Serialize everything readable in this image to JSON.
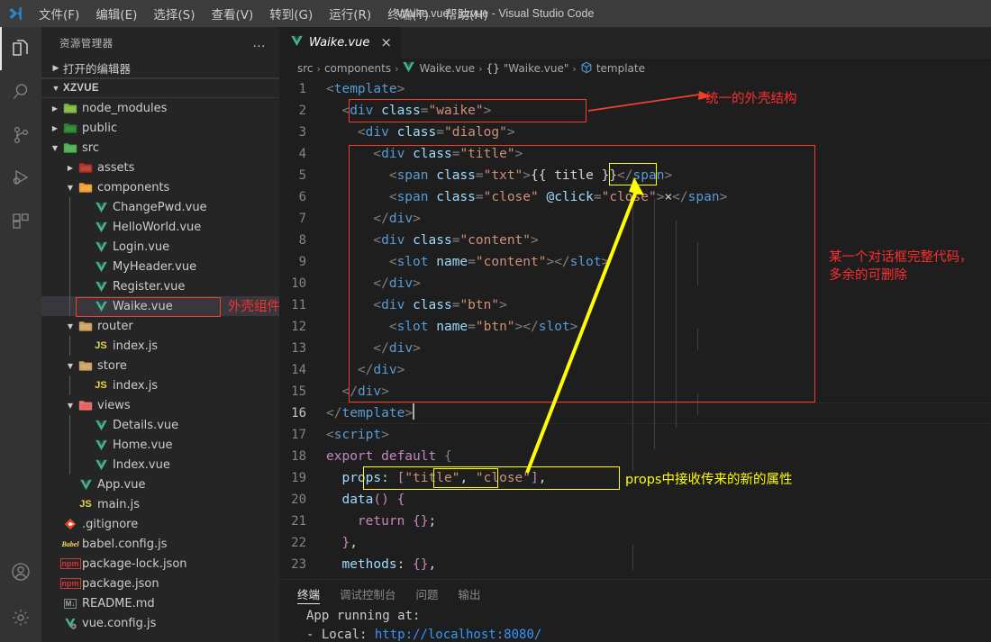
{
  "window": {
    "title": "Waike.vue - xzvue - Visual Studio Code"
  },
  "menu": {
    "items": [
      {
        "label": "文件(F)"
      },
      {
        "label": "编辑(E)"
      },
      {
        "label": "选择(S)"
      },
      {
        "label": "查看(V)"
      },
      {
        "label": "转到(G)"
      },
      {
        "label": "运行(R)"
      },
      {
        "label": "终端(T)"
      },
      {
        "label": "帮助(H)"
      }
    ]
  },
  "activitybar": {
    "items": [
      {
        "name": "explorer-icon",
        "active": true
      },
      {
        "name": "search-icon",
        "active": false
      },
      {
        "name": "source-control-icon",
        "active": false
      },
      {
        "name": "run-debug-icon",
        "active": false
      },
      {
        "name": "extensions-icon",
        "active": false
      }
    ],
    "bottom": [
      {
        "name": "account-icon"
      },
      {
        "name": "settings-gear-icon"
      }
    ]
  },
  "sidebar": {
    "header_title": "资源管理器",
    "more_actions": "…",
    "open_editors_label": "打开的编辑器",
    "project_label": "XZVUE",
    "tree": [
      {
        "label": "node_modules",
        "type": "folder",
        "depth": 1,
        "twisty": "collapsed",
        "icon": "folder-node-modules-icon"
      },
      {
        "label": "public",
        "type": "folder",
        "depth": 1,
        "twisty": "collapsed",
        "icon": "folder-public-icon"
      },
      {
        "label": "src",
        "type": "folder",
        "depth": 1,
        "twisty": "expanded",
        "icon": "folder-src-icon"
      },
      {
        "label": "assets",
        "type": "folder",
        "depth": 2,
        "twisty": "collapsed",
        "icon": "folder-assets-icon"
      },
      {
        "label": "components",
        "type": "folder",
        "depth": 2,
        "twisty": "expanded",
        "icon": "folder-components-icon"
      },
      {
        "label": "ChangePwd.vue",
        "type": "vue",
        "depth": 3,
        "twisty": "none",
        "icon": "vue-file-icon"
      },
      {
        "label": "HelloWorld.vue",
        "type": "vue",
        "depth": 3,
        "twisty": "none",
        "icon": "vue-file-icon"
      },
      {
        "label": "Login.vue",
        "type": "vue",
        "depth": 3,
        "twisty": "none",
        "icon": "vue-file-icon"
      },
      {
        "label": "MyHeader.vue",
        "type": "vue",
        "depth": 3,
        "twisty": "none",
        "icon": "vue-file-icon"
      },
      {
        "label": "Register.vue",
        "type": "vue",
        "depth": 3,
        "twisty": "none",
        "icon": "vue-file-icon"
      },
      {
        "label": "Waike.vue",
        "type": "vue",
        "depth": 3,
        "twisty": "none",
        "icon": "vue-file-icon",
        "selected": true
      },
      {
        "label": "router",
        "type": "folder",
        "depth": 2,
        "twisty": "expanded",
        "icon": "folder-icon"
      },
      {
        "label": "index.js",
        "type": "js",
        "depth": 3,
        "twisty": "none",
        "icon": "js-file-icon"
      },
      {
        "label": "store",
        "type": "folder",
        "depth": 2,
        "twisty": "expanded",
        "icon": "folder-icon"
      },
      {
        "label": "index.js",
        "type": "js",
        "depth": 3,
        "twisty": "none",
        "icon": "js-file-icon"
      },
      {
        "label": "views",
        "type": "folder",
        "depth": 2,
        "twisty": "expanded",
        "icon": "folder-views-icon"
      },
      {
        "label": "Details.vue",
        "type": "vue",
        "depth": 3,
        "twisty": "none",
        "icon": "vue-file-icon"
      },
      {
        "label": "Home.vue",
        "type": "vue",
        "depth": 3,
        "twisty": "none",
        "icon": "vue-file-icon"
      },
      {
        "label": "Index.vue",
        "type": "vue",
        "depth": 3,
        "twisty": "none",
        "icon": "vue-file-icon"
      },
      {
        "label": "App.vue",
        "type": "vue",
        "depth": 2,
        "twisty": "none",
        "icon": "vue-file-icon"
      },
      {
        "label": "main.js",
        "type": "js",
        "depth": 2,
        "twisty": "none",
        "icon": "js-file-icon"
      },
      {
        "label": ".gitignore",
        "type": "git",
        "depth": 1,
        "twisty": "none",
        "icon": "git-file-icon"
      },
      {
        "label": "babel.config.js",
        "type": "babel",
        "depth": 1,
        "twisty": "none",
        "icon": "babel-file-icon"
      },
      {
        "label": "package-lock.json",
        "type": "npm",
        "depth": 1,
        "twisty": "none",
        "icon": "npm-file-icon"
      },
      {
        "label": "package.json",
        "type": "npm",
        "depth": 1,
        "twisty": "none",
        "icon": "npm-file-icon"
      },
      {
        "label": "README.md",
        "type": "md",
        "depth": 1,
        "twisty": "none",
        "icon": "markdown-file-icon"
      },
      {
        "label": "vue.config.js",
        "type": "vueconfig",
        "depth": 1,
        "twisty": "none",
        "icon": "vue-config-file-icon"
      }
    ]
  },
  "editor": {
    "tab_label": "Waike.vue",
    "tab_close": "×",
    "breadcrumb": [
      {
        "label": "src",
        "icon": ""
      },
      {
        "label": "components",
        "icon": ""
      },
      {
        "label": "Waike.vue",
        "icon": "vue-file-icon"
      },
      {
        "label": "\"Waike.vue\"",
        "icon": "braces-icon"
      },
      {
        "label": "template",
        "icon": "symbol-module-icon"
      }
    ],
    "lines": [
      {
        "n": "1",
        "html": "<span class='brk'>&lt;</span><span class='tag'>template</span><span class='brk'>&gt;</span>"
      },
      {
        "n": "2",
        "html": "  <span class='brk'>&lt;</span><span class='tag'>div</span> <span class='attr'>class</span><span class='brk'>=</span><span class='str'>\"waike\"</span><span class='brk'>&gt;</span>"
      },
      {
        "n": "3",
        "html": "    <span class='brk'>&lt;</span><span class='tag'>div</span> <span class='attr'>class</span><span class='brk'>=</span><span class='str'>\"dialog\"</span><span class='brk'>&gt;</span>"
      },
      {
        "n": "4",
        "html": "      <span class='brk'>&lt;</span><span class='tag'>div</span> <span class='attr'>class</span><span class='brk'>=</span><span class='str'>\"title\"</span><span class='brk'>&gt;</span>"
      },
      {
        "n": "5",
        "html": "        <span class='brk'>&lt;</span><span class='tag'>span</span> <span class='attr'>class</span><span class='brk'>=</span><span class='str'>\"txt\"</span><span class='brk'>&gt;</span><span class='moust'>{{ title }}</span><span class='brk'>&lt;/</span><span class='tag'>span</span><span class='brk'>&gt;</span>"
      },
      {
        "n": "6",
        "html": "        <span class='brk'>&lt;</span><span class='tag'>span</span> <span class='attr'>class</span><span class='brk'>=</span><span class='str'>\"close\"</span> <span class='attr'>@click</span><span class='brk'>=</span><span class='str'>\"close\"</span><span class='brk'>&gt;</span><span class='txt'>×</span><span class='brk'>&lt;/</span><span class='tag'>span</span><span class='brk'>&gt;</span>"
      },
      {
        "n": "7",
        "html": "      <span class='brk'>&lt;/</span><span class='tag'>div</span><span class='brk'>&gt;</span>"
      },
      {
        "n": "8",
        "html": "      <span class='brk'>&lt;</span><span class='tag'>div</span> <span class='attr'>class</span><span class='brk'>=</span><span class='str'>\"content\"</span><span class='brk'>&gt;</span>"
      },
      {
        "n": "9",
        "html": "        <span class='brk'>&lt;</span><span class='tag'>slot</span> <span class='attr'>name</span><span class='brk'>=</span><span class='str'>\"content\"</span><span class='brk'>&gt;&lt;/</span><span class='tag'>slot</span><span class='brk'>&gt;</span>"
      },
      {
        "n": "10",
        "html": "      <span class='brk'>&lt;/</span><span class='tag'>div</span><span class='brk'>&gt;</span>"
      },
      {
        "n": "11",
        "html": "      <span class='brk'>&lt;</span><span class='tag'>div</span> <span class='attr'>class</span><span class='brk'>=</span><span class='str'>\"btn\"</span><span class='brk'>&gt;</span>"
      },
      {
        "n": "12",
        "html": "        <span class='brk'>&lt;</span><span class='tag'>slot</span> <span class='attr'>name</span><span class='brk'>=</span><span class='str'>\"btn\"</span><span class='brk'>&gt;&lt;/</span><span class='tag'>slot</span><span class='brk'>&gt;</span>"
      },
      {
        "n": "13",
        "html": "      <span class='brk'>&lt;/</span><span class='tag'>div</span><span class='brk'>&gt;</span>"
      },
      {
        "n": "14",
        "html": "    <span class='brk'>&lt;/</span><span class='tag'>div</span><span class='brk'>&gt;</span>"
      },
      {
        "n": "15",
        "html": "  <span class='brk'>&lt;/</span><span class='tag'>div</span><span class='brk'>&gt;</span>"
      },
      {
        "n": "16",
        "html": "<span class='brk'>&lt;/</span><span class='tag'>template</span><span class='brk'>&gt;</span><span class='cursor'></span>",
        "current": true
      },
      {
        "n": "17",
        "html": "<span class='brk'>&lt;</span><span class='tag'>script</span><span class='brk'>&gt;</span>"
      },
      {
        "n": "18",
        "html": "<span class='kw'>export default</span> <span class='brk'>{</span>"
      },
      {
        "n": "19",
        "html": "  <span class='prop'>props</span><span class='txt'>:</span> <span class='pnk'>[</span><span class='str'>\"title\"</span><span class='txt'>,</span> <span class='str'>\"close\"</span><span class='pnk'>]</span><span class='txt'>,</span>"
      },
      {
        "n": "20",
        "html": "  <span class='prop'>data</span><span class='pnk'>()</span> <span class='pnk'>{</span>"
      },
      {
        "n": "21",
        "html": "    <span class='kw'>return</span> <span class='pnk'>{}</span><span class='txt'>;</span>"
      },
      {
        "n": "22",
        "html": "  <span class='pnk'>}</span><span class='txt'>,</span>"
      },
      {
        "n": "23",
        "html": "  <span class='prop'>methods</span><span class='txt'>:</span> <span class='pnk'>{}</span><span class='txt'>,</span>"
      }
    ]
  },
  "annotations": [
    {
      "name": "annotation-shell-structure",
      "text": "统一的外壳结构",
      "color": "#ff2d2d"
    },
    {
      "name": "annotation-dialog-code",
      "text": "某一个对话框完整代码，\n多余的可删除",
      "color": "#ff2d2d"
    },
    {
      "name": "annotation-props-receive",
      "text": "props中接收传来的新的属性",
      "color": "#ffff00"
    },
    {
      "name": "annotation-shell-component",
      "text": "外壳组件",
      "color": "#ff2d2d"
    }
  ],
  "panel": {
    "tabs": [
      {
        "label": "终端",
        "active": true
      },
      {
        "label": "调试控制台",
        "active": false
      },
      {
        "label": "问题",
        "active": false
      },
      {
        "label": "输出",
        "active": false
      }
    ],
    "terminal_line1": "App running at:",
    "terminal_line2_prefix": "- Local:   ",
    "terminal_line2_url": "http://localhost:",
    "terminal_line2_port": "8080",
    "terminal_line2_suffix": "/"
  }
}
